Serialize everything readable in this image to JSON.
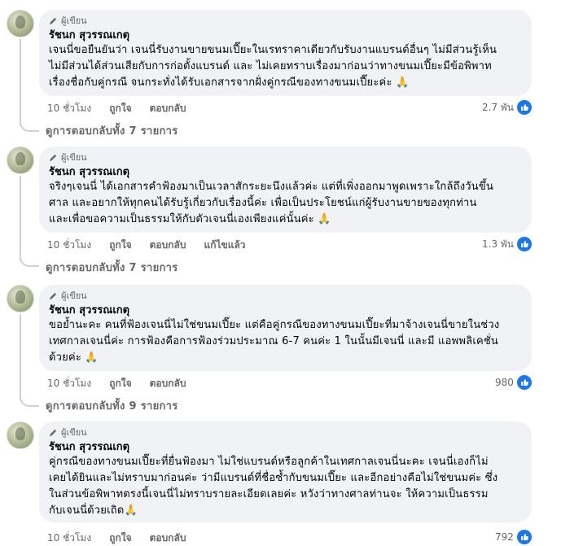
{
  "comments": [
    {
      "badge": "ผู้เขียน",
      "author": "รัชนก สุวรรณเกตุ",
      "lines": [
        "เจนนี่ขอยืนยันว่า เจนนี่รับงานขายขนมเปี๊ยะในเรทราคาเดียวกับรับงานแบรนด์อื่นๆ ไม่มีส่วนรู้เห็น",
        "ไม่มีส่วนได้ส่วนเสียกับการก่อตั้งแบรนด์ และ ไม่เคยทราบเรื่องมาก่อนว่าทางขนมเปี๊ยะมีข้อพิพาท",
        "เรื่องชื่อกับคู่กรณี จนกระทั่งได้รับเอกสารจากฝั่งคู่กรณีของทางขนมเปี๊ยะค่ะ 🙏"
      ],
      "time": "10 ชั่วโมง",
      "actions": [
        "ถูกใจ",
        "ตอบกลับ"
      ],
      "reaction_count": "2.7 พัน",
      "view_replies": "ดูการตอบกลับทั้ง 7 รายการ"
    },
    {
      "badge": "ผู้เขียน",
      "author": "รัชนก สุวรรณเกตุ",
      "lines": [
        "จริงๆเจนนี่ ได้เอกสารคำฟ้องมาเป็นเวลาสักระยะนึงแล้วค่ะ แต่ที่เพิ่งออกมาพูดเพราะใกล้ถึงวันขึ้น",
        "ศาล และอยากให้ทุกคนได้รับรู้เกี่ยวกับเรื่องนี้ค่ะ เพื่อเป็นประโยชน์แก่ผู้รับงานขายของทุกท่าน",
        "และเพื่อขอความเป็นธรรมให้กับตัวเจนนี่เองเพียงแค่นั้นค่ะ 🙏"
      ],
      "time": "10 ชั่วโมง",
      "actions": [
        "ถูกใจ",
        "ตอบกลับ",
        "แก้ไขแล้ว"
      ],
      "reaction_count": "1.3 พัน",
      "view_replies": "ดูการตอบกลับทั้ง 7 รายการ"
    },
    {
      "badge": "ผู้เขียน",
      "author": "รัชนก สุวรรณเกตุ",
      "lines": [
        "ขอย้ำนะคะ คนที่ฟ้องเจนนี่ไม่ใช่ขนมเปี๊ยะ แต่คือคู่กรณีของทางขนมเปี๊ยะที่มาจ้างเจนนี่ขายในช่วง",
        "เทศกาลเจนนี่ค่ะ การฟ้องคือการฟ้องร่วมประมาณ 6-7 คนค่ะ 1 ในนั้นมีเจนนี่ และมี แอพพลิเคชั่น",
        "ด้วยค่ะ 🙏"
      ],
      "time": "10 ชั่วโมง",
      "actions": [
        "ถูกใจ",
        "ตอบกลับ"
      ],
      "reaction_count": "980",
      "view_replies": "ดูการตอบกลับทั้ง 9 รายการ"
    },
    {
      "badge": "ผู้เขียน",
      "author": "รัชนก สุวรรณเกตุ",
      "lines": [
        "คู่กรณีของทางขนมเปี๊ยะที่ยื่นฟ้องมา ไม่ใช่แบรนด์หรือลูกค้าในเทศกาลเจนนี่นะคะ เจนนี่เองก็ไม่",
        "เคยได้ยินและไม่ทราบมาก่อนค่ะ ว่ามีแบรนด์ที่ชื่อซ้ำกับขนมเปี๊ยะ และอีกอย่างคือไม่ใช่ขนมค่ะ ซึ่ง",
        "ในส่วนข้อพิพาทตรงนี้เจนนี่ไม่ทราบรายละเอียดเลยค่ะ หวังว่าทางศาลท่านจะ ให้ความเป็นธรรม",
        "กับเจนนี่ด้วยเถิด🙏"
      ],
      "time": "10 ชั่วโมง",
      "actions": [
        "ถูกใจ",
        "ตอบกลับ"
      ],
      "reaction_count": "792",
      "view_replies": ""
    }
  ]
}
